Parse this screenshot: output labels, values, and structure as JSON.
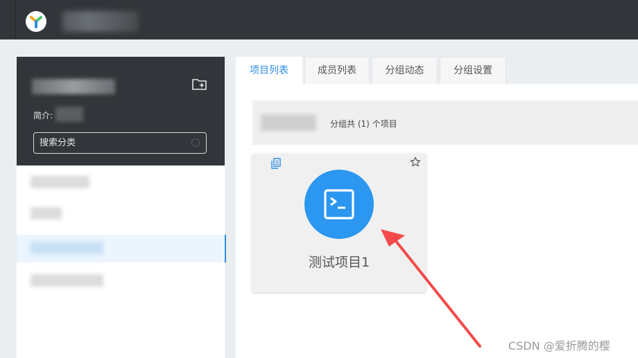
{
  "topbar": {
    "logo_icon": "yapi-logo-icon"
  },
  "sidebar": {
    "intro_label": "简介:",
    "search_placeholder": "搜索分类",
    "add_group_icon": "folder-add-icon",
    "category_count": 4,
    "active_category_index": 2
  },
  "tabs": [
    {
      "label": "项目列表",
      "active": true
    },
    {
      "label": "成员列表",
      "active": false
    },
    {
      "label": "分组动态",
      "active": false
    },
    {
      "label": "分组设置",
      "active": false
    }
  ],
  "summary": {
    "text": "分组共 (1) 个项目"
  },
  "project_card": {
    "name": "测试项目1",
    "icon": "terminal-icon",
    "copy_icon": "document-icon",
    "follow_icon": "star-icon"
  },
  "colors": {
    "accent": "#2e8ee5",
    "topbar": "#32363a",
    "project_icon_bg": "#2b97f0",
    "annotation_arrow": "#f24a4a"
  },
  "watermark": "CSDN @爱折腾的樱"
}
